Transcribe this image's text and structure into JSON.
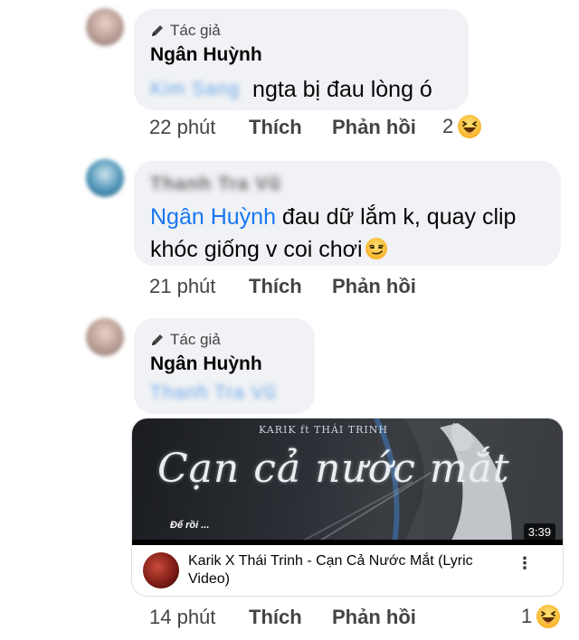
{
  "comments": [
    {
      "badge": "Tác giả",
      "author": "Ngân Huỳnh",
      "mention": "Kim Sang",
      "text": "ngta bị đau lòng ó",
      "time": "22 phút",
      "like": "Thích",
      "reply": "Phản hồi",
      "reaction_count": "2",
      "reaction_icon": "haha-icon"
    },
    {
      "author": "Thanh Tra Vũ",
      "mention": "Ngân Huỳnh",
      "text": " đau dữ lắm k, quay clip khóc giống v coi chơi",
      "emoji": "smirk-icon",
      "time": "21 phút",
      "like": "Thích",
      "reply": "Phản hồi"
    },
    {
      "badge": "Tác giả",
      "author": "Ngân Huỳnh",
      "mention": "Thanh Tra Vũ",
      "time": "14 phút",
      "like": "Thích",
      "reply": "Phản hồi",
      "reaction_count": "1",
      "reaction_icon": "haha-icon",
      "video": {
        "thumb_title": "Cạn cả nước mắt",
        "credit": "KARIK ft THÁI TRINH",
        "caption": "Để rồi ...",
        "duration": "3:39",
        "title": "Karik X Thái Trinh - Cạn Cả Nước Mắt (Lyric Video)",
        "more": "⋮"
      }
    }
  ],
  "colors": {
    "bubble": "#f0f2f5",
    "mention": "#1877f2",
    "secondary_text": "#444444"
  }
}
